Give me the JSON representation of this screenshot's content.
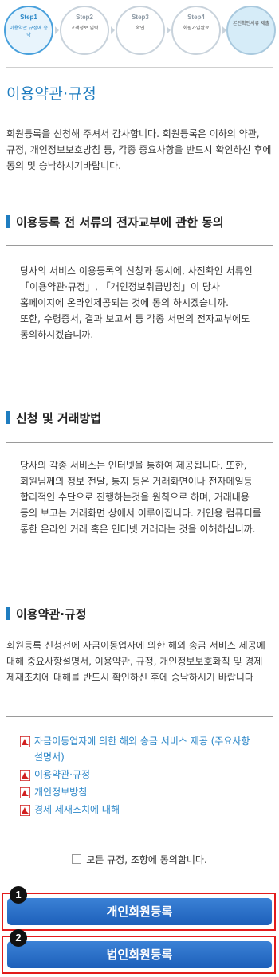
{
  "steps": [
    {
      "num": "Step1",
      "label": "이용약관 규정에 승낙"
    },
    {
      "num": "Step2",
      "label": "고객정보 입력"
    },
    {
      "num": "Step3",
      "label": "확인"
    },
    {
      "num": "Step4",
      "label": "회원가입완료"
    },
    {
      "num": "",
      "label": "본인확인서류 제출"
    }
  ],
  "page_title": "이용약관·규정",
  "intro": "회원등록을 신청해 주셔서 감사합니다. 회원등록은 이하의 약관, 규정, 개인정보보호방침 등, 각종 중요사항을 반드시 확인하신 후에 동의 및 승낙하시기바랍니다.",
  "sections": {
    "electronic": {
      "title": "이용등록 전 서류의 전자교부에 관한 동의",
      "body": "당사의 서비스 이용등록의 신청과 동시에, 사전확인 서류인 「이용약관·규정」, 「개인정보취급방침」이 당사 홈페이지에 온라인제공되는 것에 동의 하시겠습니까.\n또한, 수령증서, 결과 보고서 등 각종 서면의 전자교부에도 동의하시겠습니까."
    },
    "transaction": {
      "title": "신청 및 거래방법",
      "body": "당사의 각종 서비스는 인터넷을 통하여 제공됩니다. 또한, 회원님께의 정보 전달, 통지 등은 거래화면이나 전자메일등 합리적인 수단으로 진행하는것을 원칙으로 하며, 거래내용 등의 보고는 거래화면 상에서 이루어집니다. 개인용 컴퓨터를 통한 온라인 거래 혹은 인터넷 거래라는 것을 이해하십니까."
    },
    "terms": {
      "title": "이용약관·규정",
      "body": "회원등록 신청전에 자금이동업자에 의한 해외 송금 서비스 제공에 대해 중요사항설명서, 이용약관, 규정, 개인정보보호화칙 및 경제 제재조치에 대해를 반드시 확인하신 후에 승낙하시기 바랍니다"
    }
  },
  "documents": [
    "자금이동업자에 의한 해외 송금 서비스 제공 (주요사항 설명서)",
    "이용약관·규정",
    "개인정보방침",
    "경제 제재조치에 대해"
  ],
  "icons": {
    "document": "pdf-icon",
    "agree": "checkbox"
  },
  "agree_label": "모든 규정, 조항에 동의합니다.",
  "buttons": {
    "personal": {
      "marker": "1",
      "label": "개인회원등록"
    },
    "corporate": {
      "marker": "2",
      "label": "법인회원등록"
    }
  },
  "colors": {
    "accent": "#1f7dc0",
    "link": "#2a86c8",
    "button": "#2a6fcb",
    "highlight": "#e31b1b"
  }
}
